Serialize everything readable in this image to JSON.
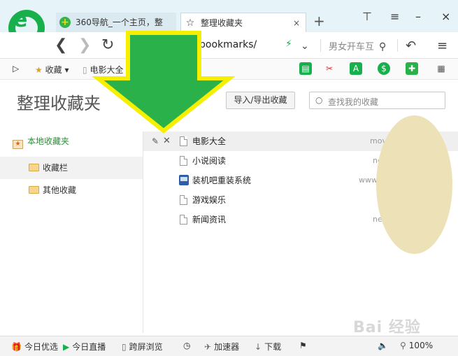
{
  "tabs": {
    "tab1": "360导航_一个主页，整",
    "tab2": "整理收藏夹",
    "close": "×",
    "new": "+"
  },
  "window": {
    "shirt": "⊤",
    "min": "–",
    "max": "□",
    "close": "×"
  },
  "address": {
    "url": "bookmarks/",
    "search_hint": "男女开车互",
    "back": "❮",
    "forward": "❯",
    "reload": "↻"
  },
  "bookmarks_bar": {
    "expand": "▷",
    "favorites": "收藏",
    "favorites_arrow": "▾",
    "movies": "电影大全"
  },
  "page": {
    "title": "整理收藏夹",
    "import_export": "导入/导出收藏",
    "search_placeholder": "查找我的收藏"
  },
  "sidebar": {
    "local": "本地收藏夹",
    "folders": [
      "收藏栏",
      "其他收藏"
    ]
  },
  "list": [
    {
      "name": "电影大全",
      "url": "mov"
    },
    {
      "name": "小说阅读",
      "url": "ne"
    },
    {
      "name": "装机吧重装系统",
      "url": "www"
    },
    {
      "name": "游戏娱乐",
      "url": ""
    },
    {
      "name": "新闻资讯",
      "url": "ne"
    }
  ],
  "status": {
    "today_pick": "今日优选",
    "today_live": "今日直播",
    "cross_screen": "跨屏浏览",
    "accelerator": "加速器",
    "download": "下载",
    "zoom": "100%"
  },
  "watermark": "Bai 经验",
  "colors": {
    "accent": "#17b04c",
    "arrow_fill": "#2ab14a",
    "arrow_border": "#f6ef00"
  }
}
